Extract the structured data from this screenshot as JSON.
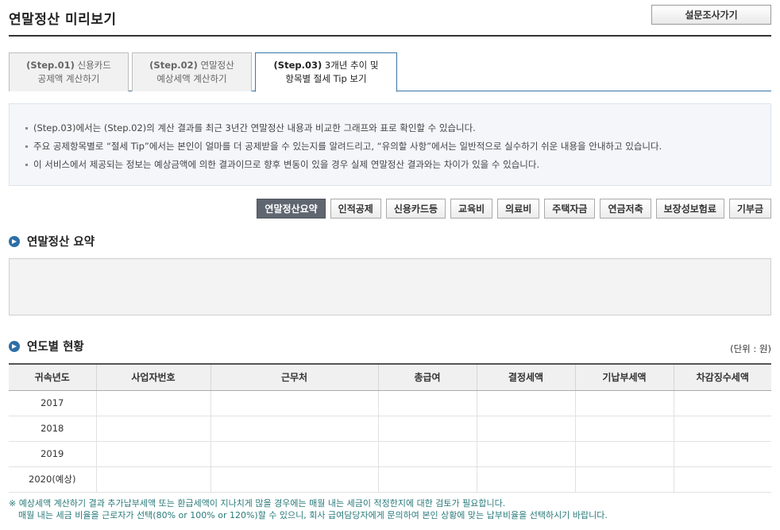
{
  "header": {
    "title": "연말정산 미리보기",
    "survey_button": "설문조사가기"
  },
  "tabs": [
    {
      "step": "(Step.01)",
      "line1": "신용카드",
      "line2": "공제액 계산하기"
    },
    {
      "step": "(Step.02)",
      "line1": "연말정산",
      "line2": "예상세액 계산하기"
    },
    {
      "step": "(Step.03)",
      "line1": "3개년 추이 및",
      "line2": "항목별 절세 Tip 보기"
    }
  ],
  "info": [
    "(Step.03)에서는 (Step.02)의 계산 결과를 최근 3년간 연말정산 내용과 비교한 그래프와 표로 확인할 수 있습니다.",
    "주요 공제항목별로 “절세 Tip”에서는 본인이 얼마를 더 공제받을 수 있는지를 알려드리고, “유의할 사항”에서는 일반적으로 실수하기 쉬운 내용을 안내하고 있습니다.",
    "이 서비스에서 제공되는 정보는 예상금액에 의한 결과이므로 향후 변동이 있을 경우 실제 연말정산 결과와는 차이가 있을 수 있습니다."
  ],
  "categories": [
    "연말정산요약",
    "인적공제",
    "신용카드등",
    "교육비",
    "의료비",
    "주택자금",
    "연금저축",
    "보장성보험료",
    "기부금"
  ],
  "summary": {
    "title": "연말정산 요약"
  },
  "yearly": {
    "title": "연도별 현황",
    "unit": "(단위 : 원)",
    "columns": [
      "귀속년도",
      "사업자번호",
      "근무처",
      "총급여",
      "결정세액",
      "기납부세액",
      "차감징수세액"
    ],
    "rows": [
      "2017",
      "2018",
      "2019",
      "2020(예상)"
    ]
  },
  "notes": {
    "line1": "※ 예상세액 계산하기 결과 추가납부세액 또는 환급세액이 지나치게 많을 경우에는 매월 내는 세금이 적정한지에 대한 검토가 필요합니다.",
    "line2": "매월 내는 세금 비율을 근로자가 선택(80% or 100% or 120%)할 수 있으니, 회사 급여담당자에게 문의하여 본인 상황에 맞는 납부비율을 선택하시기 바랍니다."
  },
  "colors": {
    "accent": "#2d6fa8",
    "active_category": "#5f6670",
    "note": "#2a7a7a"
  }
}
